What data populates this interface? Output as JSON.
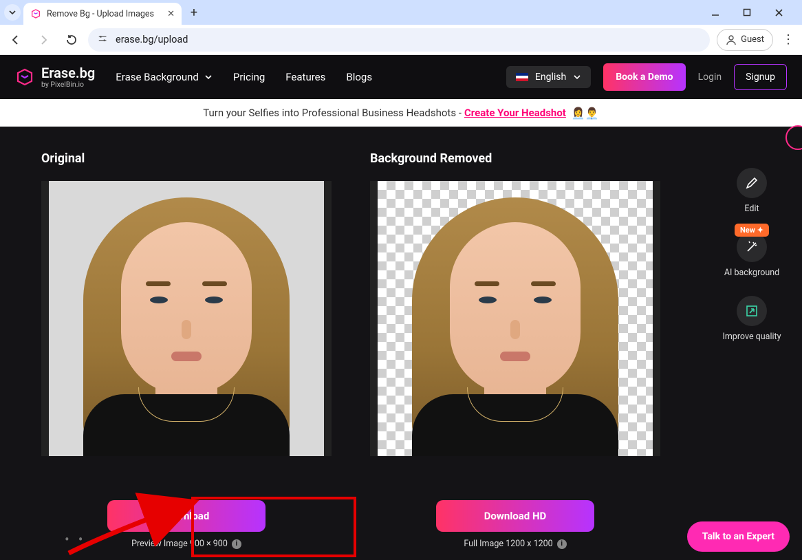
{
  "browser": {
    "tab_title": "Remove Bg - Upload Images",
    "url": "erase.bg/upload",
    "guest_label": "Guest"
  },
  "header": {
    "brand_name": "Erase.bg",
    "brand_sub": "by PixelBin.io",
    "nav": {
      "erase_bg": "Erase Background",
      "pricing": "Pricing",
      "features": "Features",
      "blogs": "Blogs"
    },
    "language": "English",
    "demo": "Book a Demo",
    "login": "Login",
    "signup": "Signup"
  },
  "banner": {
    "text": "Turn your Selfies into Professional Business Headshots - ",
    "link": "Create Your Headshot"
  },
  "columns": {
    "original": "Original",
    "removed": "Background Removed"
  },
  "tools": {
    "edit": "Edit",
    "ai_bg": "AI background",
    "new_badge": "New",
    "improve": "Improve quality"
  },
  "downloads": {
    "download": "Download",
    "download_hd": "Download HD",
    "preview_sub": "Preview Image 900 × 900",
    "full_sub": "Full Image 1200 x 1200"
  },
  "expert": "Talk to an Expert"
}
